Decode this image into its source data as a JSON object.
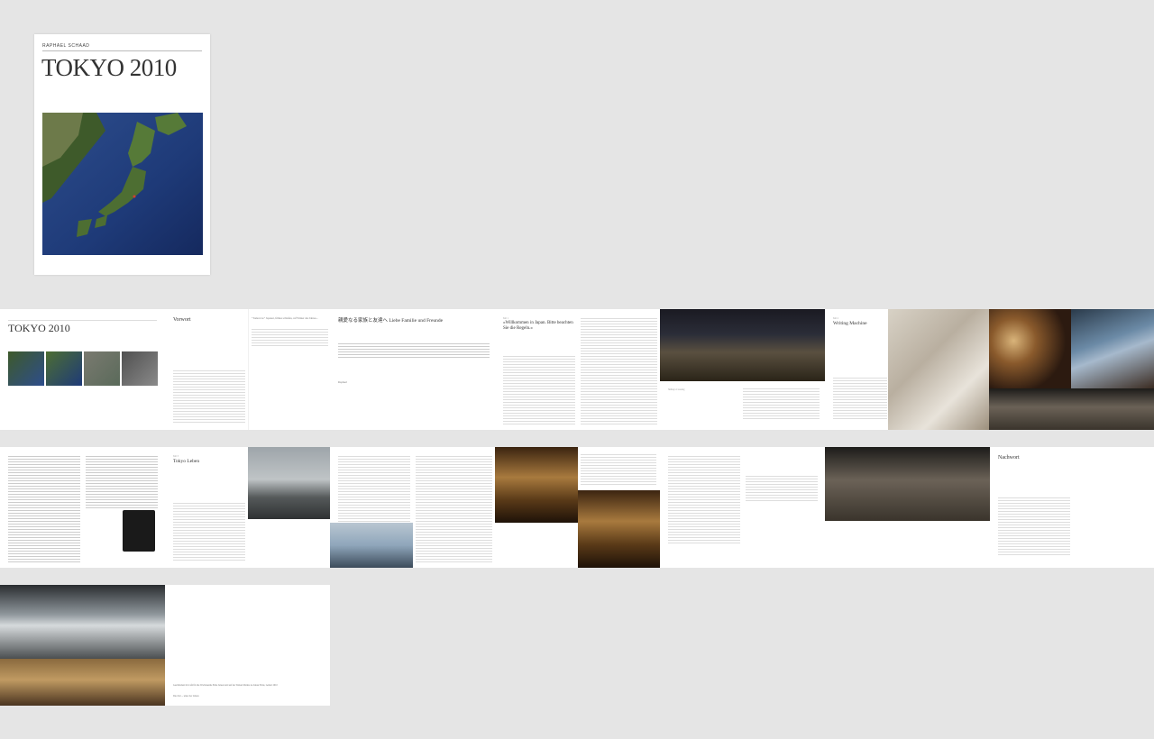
{
  "cover": {
    "author": "RAPHAEL SCHAAD",
    "title": "TOKYO 2010"
  },
  "strip1": {
    "p1_title": "TOKYO 2010",
    "p2_heading": "Vorwort",
    "p3_intro": "\"Tomorrow\" Japaner, frühes schlafen, ruf Winter des Jahres...",
    "p4_heading": "親愛なる家族と友達へ Liebe Familie und Freunde",
    "p4_sign": "Raphael",
    "p5_kicker": "Teil 1",
    "p5_heading": "«Willkommen in Japan. Bitte beachten Sie die Regeln.»",
    "p7_caption": "Shibuya Crossing",
    "p8_kicker": "Teil 2",
    "p8_heading": "Writing Machine"
  },
  "strip2": {
    "p3_kicker": "Teil 3",
    "p3_heading": "Tokyo Leben",
    "p12_heading": "Nachwort"
  },
  "strip3": {
    "p2_text1": "Geschrieben im Café für die Wochenende Ende Januar und auf der Tainan Marine zu Januar Ende, Geburt 2010",
    "p2_text2": "Die Zeit ... unter der Linien"
  }
}
